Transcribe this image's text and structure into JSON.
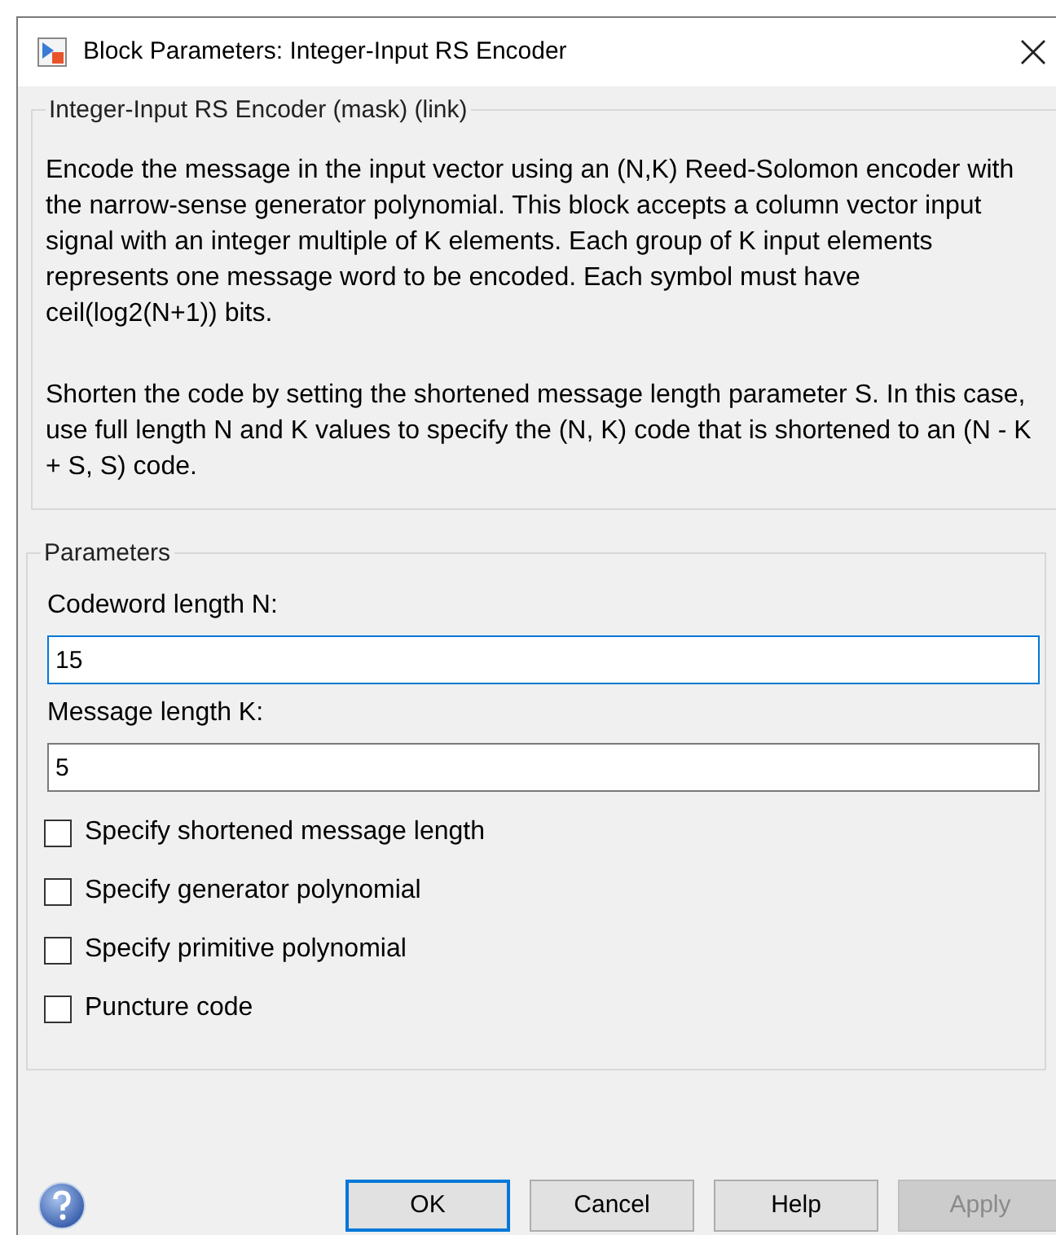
{
  "window": {
    "title": "Block Parameters: Integer-Input RS Encoder"
  },
  "description_group": {
    "title": "Integer-Input RS Encoder (mask) (link)",
    "paragraphs": [
      "Encode the message in the input vector using an (N,K) Reed-Solomon encoder with the narrow-sense generator polynomial.  This block accepts a column vector input signal with an integer multiple of K elements.  Each group of K input elements represents one message word to be encoded.  Each symbol must have ceil(log2(N+1)) bits.",
      "Shorten the code by setting the shortened message length parameter S. In this case, use full length N and K values to specify the (N, K) code that is shortened to an (N - K + S, S) code."
    ]
  },
  "parameters_group": {
    "title": "Parameters",
    "fields": [
      {
        "label": "Codeword length N:",
        "value": "15",
        "focused": true
      },
      {
        "label": "Message length K:",
        "value": "5",
        "focused": false
      }
    ],
    "checkboxes": [
      {
        "label": "Specify shortened message length",
        "checked": false
      },
      {
        "label": "Specify generator polynomial",
        "checked": false
      },
      {
        "label": "Specify primitive polynomial",
        "checked": false
      },
      {
        "label": "Puncture code",
        "checked": false
      }
    ]
  },
  "buttons": [
    {
      "label": "OK",
      "default": true,
      "disabled": false
    },
    {
      "label": "Cancel",
      "default": false,
      "disabled": false
    },
    {
      "label": "Help",
      "default": false,
      "disabled": false
    },
    {
      "label": "Apply",
      "default": false,
      "disabled": true
    }
  ]
}
